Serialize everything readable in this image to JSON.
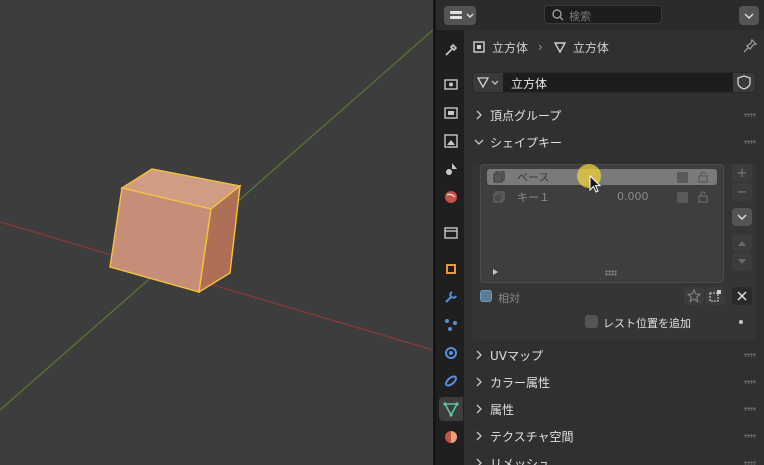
{
  "header": {
    "search_placeholder": "検索"
  },
  "breadcrumb": {
    "object_name": "立方体",
    "mesh_name": "立方体"
  },
  "mesh_datablock": {
    "name": "立方体"
  },
  "panels": {
    "vertex_groups": "頂点グループ",
    "shape_keys": "シェイプキー",
    "uv_maps": "UVマップ",
    "color_attributes": "カラー属性",
    "attributes": "属性",
    "texture_space": "テクスチャ空間",
    "remesh": "リメッシュ"
  },
  "shape_keys": {
    "items": [
      {
        "name": "ベース",
        "value": ""
      },
      {
        "name": "キー１",
        "value": "0.000"
      }
    ],
    "relative_label": "相対",
    "add_rest_position_label": "レスト位置を追加",
    "plus": "+",
    "minus": "−"
  },
  "colors": {
    "accent_yellow": "#f3c43c",
    "cube_face": "#c8907a",
    "tab_active": "#3d3d3d"
  }
}
